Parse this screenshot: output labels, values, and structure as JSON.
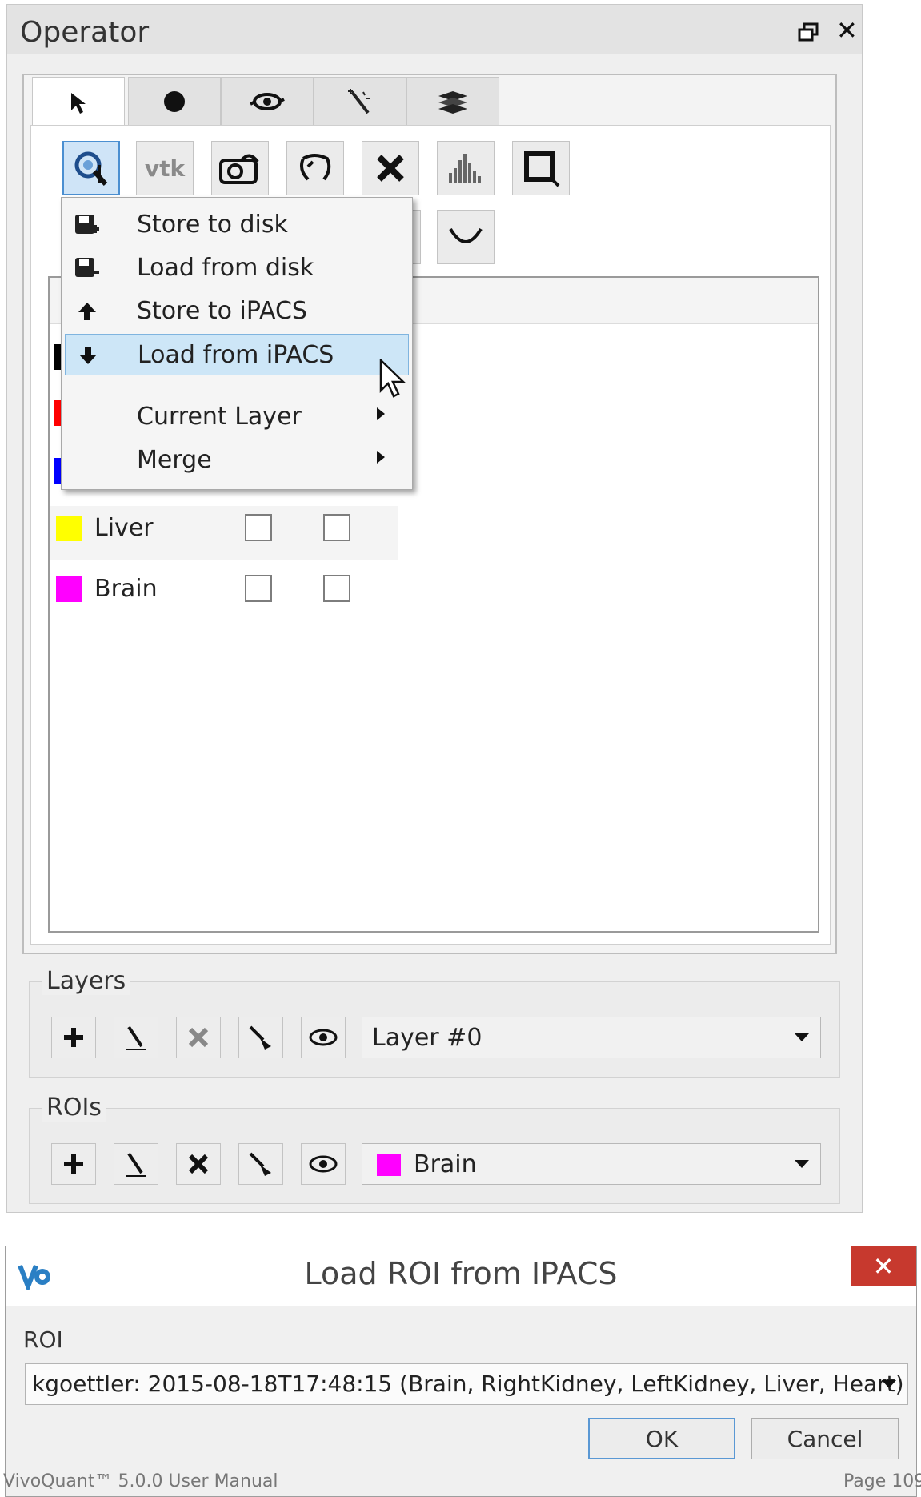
{
  "operator": {
    "title": "Operator",
    "tabs": [
      {
        "icon": "pointer-icon"
      },
      {
        "icon": "circle-icon"
      },
      {
        "icon": "eye-icon"
      },
      {
        "icon": "magic-wand-icon"
      },
      {
        "icon": "layers-icon"
      }
    ],
    "toolbar": {
      "vtk_label": "vtk"
    },
    "context_menu": {
      "items": [
        {
          "label": "Store to disk",
          "icon": "save-icon"
        },
        {
          "label": "Load from disk",
          "icon": "save-icon"
        },
        {
          "label": "Store to iPACS",
          "icon": "arrow-up-icon"
        },
        {
          "label": "Load from iPACS",
          "icon": "arrow-down-icon",
          "highlighted": true
        },
        {
          "label": "Current Layer",
          "submenu": true
        },
        {
          "label": "Merge",
          "submenu": true
        }
      ]
    },
    "rois": [
      {
        "name": "Liver",
        "color": "#ffff00"
      },
      {
        "name": "Brain",
        "color": "#ff00ff"
      }
    ],
    "partial_row_colors": [
      "#000000",
      "#ff0000",
      "#0000ff"
    ],
    "layers_group": {
      "title": "Layers",
      "selected": "Layer #0"
    },
    "rois_group": {
      "title": "ROIs",
      "selected": "Brain",
      "selected_color": "#ff00ff"
    }
  },
  "dialog": {
    "title": "Load ROI from IPACS",
    "close_glyph": "✕",
    "roi_label": "ROI",
    "roi_value": "kgoettler: 2015-08-18T17:48:15 (Brain, RightKidney, LeftKidney, Liver, Heart)",
    "ok_label": "OK",
    "cancel_label": "Cancel"
  },
  "footer": {
    "left": "VivoQuant™ 5.0.0 User Manual",
    "right": "Page 109"
  }
}
